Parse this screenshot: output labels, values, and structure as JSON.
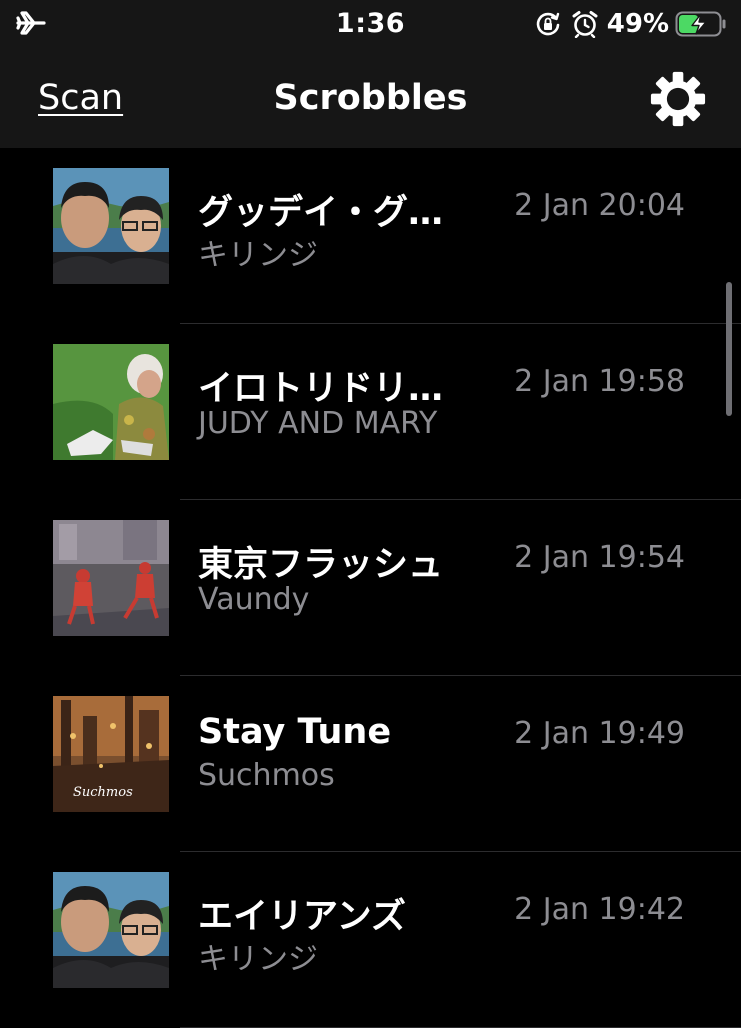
{
  "status_bar": {
    "time": "1:36",
    "battery_percent": "49%",
    "icons": [
      "airplane-icon",
      "orientation-lock-icon",
      "alarm-clock-icon",
      "battery-charging-icon"
    ],
    "battery_level": 0.49,
    "battery_color": "#4cd964"
  },
  "nav": {
    "scan_label": "Scan",
    "title": "Scrobbles",
    "settings_icon": "gear-icon"
  },
  "scrobbles": [
    {
      "track": "グッデイ・グ…",
      "artist": "キリンジ",
      "date": "2 Jan 20:04"
    },
    {
      "track": "イロトリドリ…",
      "artist": "JUDY AND MARY",
      "date": "2 Jan 19:58"
    },
    {
      "track": "東京フラッシュ",
      "artist": "Vaundy",
      "date": "2 Jan 19:54"
    },
    {
      "track": "Stay Tune",
      "artist": "Suchmos",
      "date": "2 Jan 19:49",
      "art_text": "Suchmos"
    },
    {
      "track": "エイリアンズ",
      "artist": "キリンジ",
      "date": "2 Jan 19:42"
    }
  ],
  "colors": {
    "background": "#000000",
    "bar_background": "#161616",
    "secondary_text": "#8d8d92",
    "separator": "#2c2c2e"
  }
}
